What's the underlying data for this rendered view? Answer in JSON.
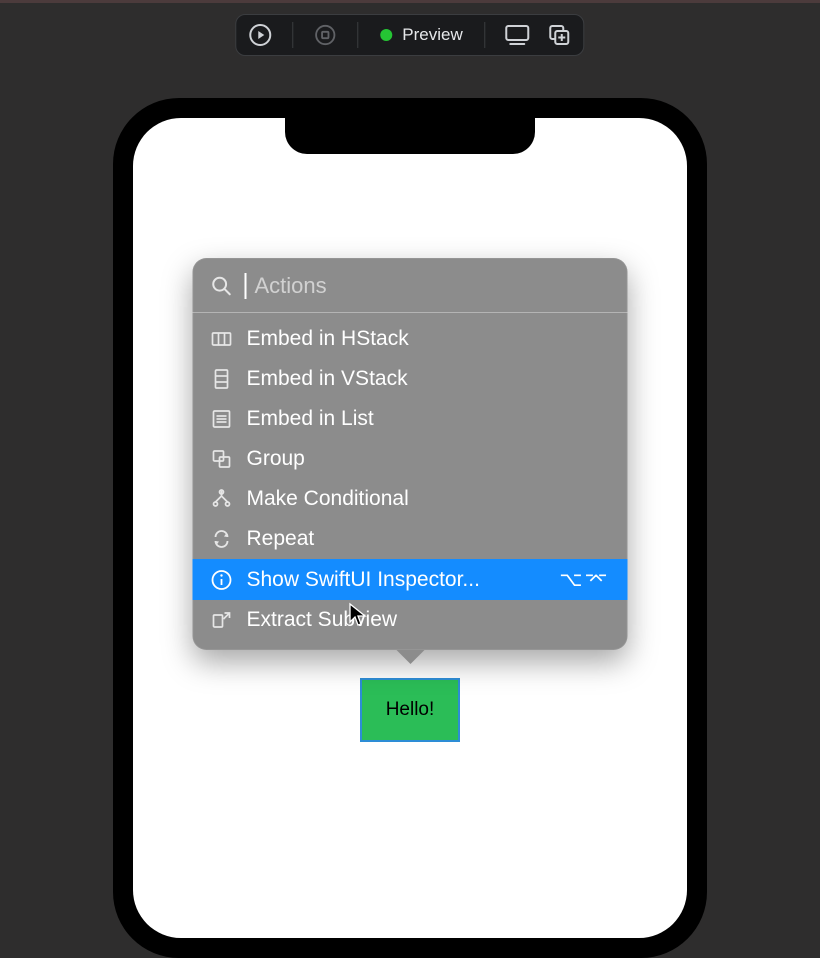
{
  "toolbar": {
    "preview_label": "Preview",
    "status": "running"
  },
  "popover": {
    "search_placeholder": "Actions",
    "items": [
      {
        "label": "Embed in HStack",
        "icon": "embed-hstack-icon",
        "selected": false
      },
      {
        "label": "Embed in VStack",
        "icon": "embed-vstack-icon",
        "selected": false
      },
      {
        "label": "Embed in List",
        "icon": "embed-list-icon",
        "selected": false
      },
      {
        "label": "Group",
        "icon": "group-icon",
        "selected": false
      },
      {
        "label": "Make Conditional",
        "icon": "conditional-icon",
        "selected": false
      },
      {
        "label": "Repeat",
        "icon": "repeat-icon",
        "selected": false
      },
      {
        "label": "Show SwiftUI Inspector...",
        "icon": "info-icon",
        "selected": true,
        "shortcut": "⌥⌤"
      },
      {
        "label": "Extract Subview",
        "icon": "extract-icon",
        "selected": false
      }
    ]
  },
  "canvas": {
    "selected_view_text": "Hello!"
  }
}
